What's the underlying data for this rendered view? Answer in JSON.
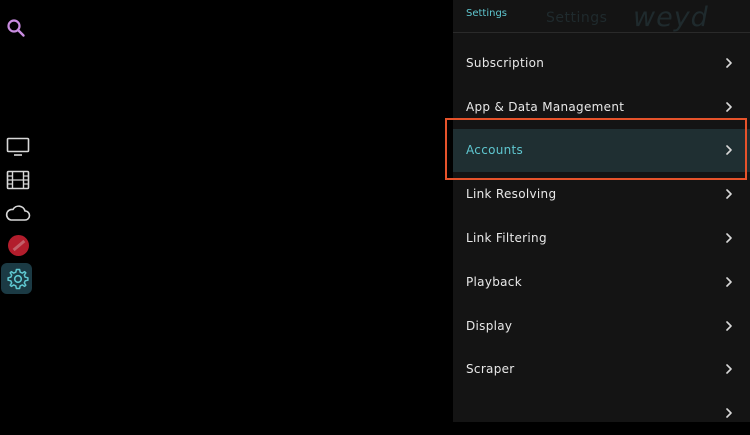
{
  "icons": {
    "search": "search-icon",
    "tv": "tv-icon",
    "movies": "film-icon",
    "cloud": "cloud-icon",
    "profile": "avatar",
    "settings": "gear-icon",
    "chevron": "chevron-right-icon"
  },
  "colors": {
    "accent": "#5fc7d0",
    "search": "#c98ce0",
    "highlight": "#e6532b",
    "profile": "#b21d2c"
  },
  "settings": {
    "header": "Settings",
    "ghost_title": "Settings",
    "ghost_logo": "weyd",
    "items": [
      {
        "label": "Subscription"
      },
      {
        "label": "App & Data Management"
      },
      {
        "label": "Accounts"
      },
      {
        "label": "Link Resolving"
      },
      {
        "label": "Link Filtering"
      },
      {
        "label": "Playback"
      },
      {
        "label": "Display"
      },
      {
        "label": "Scraper"
      },
      {
        "label": ""
      }
    ],
    "selected_index": 2
  }
}
